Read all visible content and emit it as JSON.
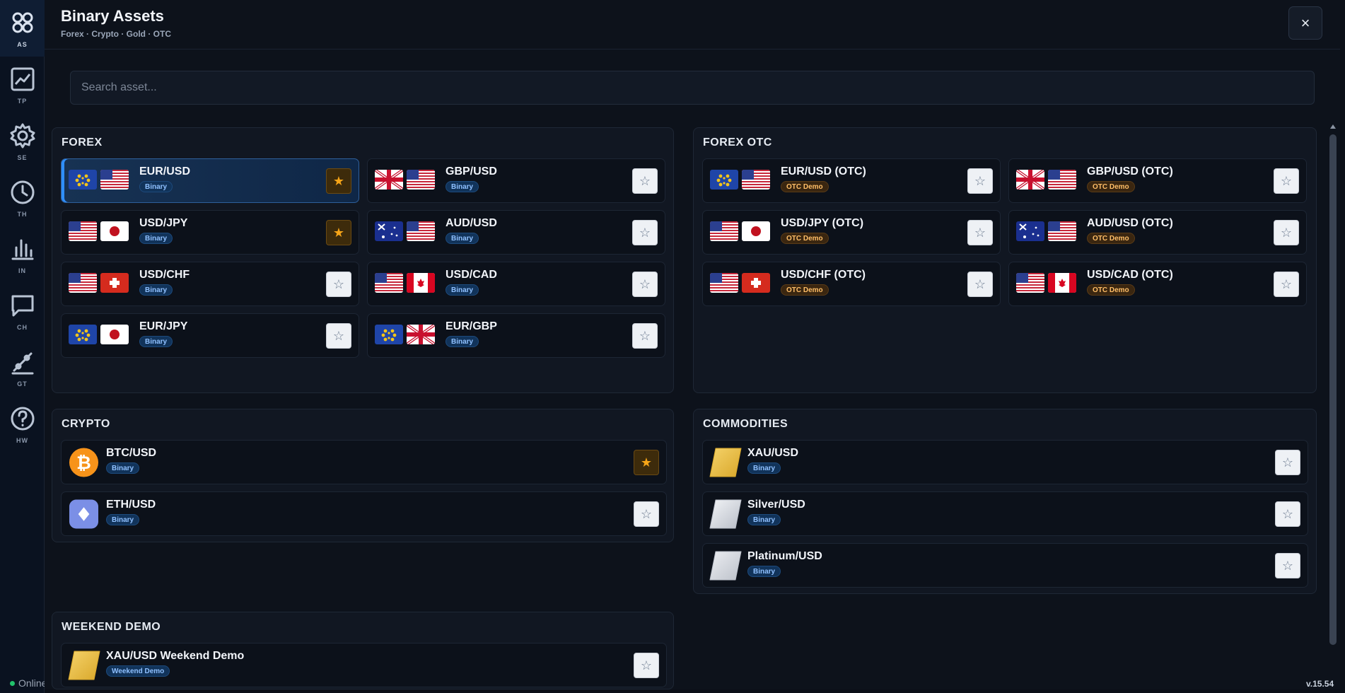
{
  "rail": {
    "items": [
      {
        "label": "AS",
        "icon": "grid-icon"
      },
      {
        "label": "TP",
        "icon": "chart-line-icon"
      },
      {
        "label": "SE",
        "icon": "gear-icon"
      },
      {
        "label": "TH",
        "icon": "clock-icon"
      },
      {
        "label": "IN",
        "icon": "bar-chart-icon"
      },
      {
        "label": "CH",
        "icon": "chat-icon"
      },
      {
        "label": "GT",
        "icon": "tool-icon"
      },
      {
        "label": "HW",
        "icon": "help-icon"
      }
    ],
    "status": "Online"
  },
  "modal": {
    "title": "Binary Assets",
    "subtitle": "Forex · Crypto · Gold · OTC",
    "close_label": "×"
  },
  "search": {
    "placeholder": "Search asset..."
  },
  "sections": {
    "forex": {
      "title": "FOREX",
      "assets": [
        {
          "name": "EUR/USD",
          "badge": "Binary",
          "flags": [
            "eu",
            "us"
          ],
          "favorite": true,
          "selected": true
        },
        {
          "name": "GBP/USD",
          "badge": "Binary",
          "flags": [
            "gb",
            "us"
          ],
          "favorite": false
        },
        {
          "name": "USD/JPY",
          "badge": "Binary",
          "flags": [
            "us",
            "jp"
          ],
          "favorite": true
        },
        {
          "name": "AUD/USD",
          "badge": "Binary",
          "flags": [
            "au",
            "us"
          ],
          "favorite": false
        },
        {
          "name": "USD/CHF",
          "badge": "Binary",
          "flags": [
            "us",
            "ch"
          ],
          "favorite": false
        },
        {
          "name": "USD/CAD",
          "badge": "Binary",
          "flags": [
            "us",
            "ca"
          ],
          "favorite": false
        },
        {
          "name": "EUR/JPY",
          "badge": "Binary",
          "flags": [
            "eu",
            "jp"
          ],
          "favorite": false
        },
        {
          "name": "EUR/GBP",
          "badge": "Binary",
          "flags": [
            "eu",
            "gb"
          ],
          "favorite": false
        }
      ]
    },
    "forex_otc": {
      "title": "FOREX OTC",
      "assets": [
        {
          "name": "EUR/USD (OTC)",
          "badge": "OTC Demo",
          "flags": [
            "eu",
            "us"
          ],
          "favorite": false
        },
        {
          "name": "GBP/USD (OTC)",
          "badge": "OTC Demo",
          "flags": [
            "gb",
            "us"
          ],
          "favorite": false
        },
        {
          "name": "USD/JPY (OTC)",
          "badge": "OTC Demo",
          "flags": [
            "us",
            "jp"
          ],
          "favorite": false
        },
        {
          "name": "AUD/USD (OTC)",
          "badge": "OTC Demo",
          "flags": [
            "au",
            "us"
          ],
          "favorite": false
        },
        {
          "name": "USD/CHF (OTC)",
          "badge": "OTC Demo",
          "flags": [
            "us",
            "ch"
          ],
          "favorite": false
        },
        {
          "name": "USD/CAD (OTC)",
          "badge": "OTC Demo",
          "flags": [
            "us",
            "ca"
          ],
          "favorite": false
        }
      ]
    },
    "crypto": {
      "title": "CRYPTO",
      "assets": [
        {
          "name": "BTC/USD",
          "badge": "Binary",
          "icon": "bitcoin-icon",
          "favorite": true
        },
        {
          "name": "ETH/USD",
          "badge": "Binary",
          "icon": "ethereum-icon",
          "favorite": false
        }
      ]
    },
    "commodities": {
      "title": "COMMODITIES",
      "assets": [
        {
          "name": "XAU/USD",
          "badge": "Binary",
          "icon": "gold-bar-icon",
          "favorite": false
        },
        {
          "name": "Silver/USD",
          "badge": "Binary",
          "icon": "silver-bar-icon",
          "favorite": false
        },
        {
          "name": "Platinum/USD",
          "badge": "Binary",
          "icon": "platinum-bar-icon",
          "favorite": false
        }
      ]
    },
    "weekend_demo": {
      "title": "WEEKEND DEMO",
      "assets": [
        {
          "name": "XAU/USD Weekend Demo",
          "badge": "Weekend Demo",
          "icon": "gold-bar-icon",
          "favorite": false
        }
      ]
    }
  },
  "star_filled": "★",
  "star_empty": "☆",
  "version": "v.15.54",
  "colors": {
    "accent": "#2f8fff",
    "favorite": "#f6a518",
    "otc_badge": "#ffbe67",
    "binary_badge": "#8fc0ff"
  }
}
